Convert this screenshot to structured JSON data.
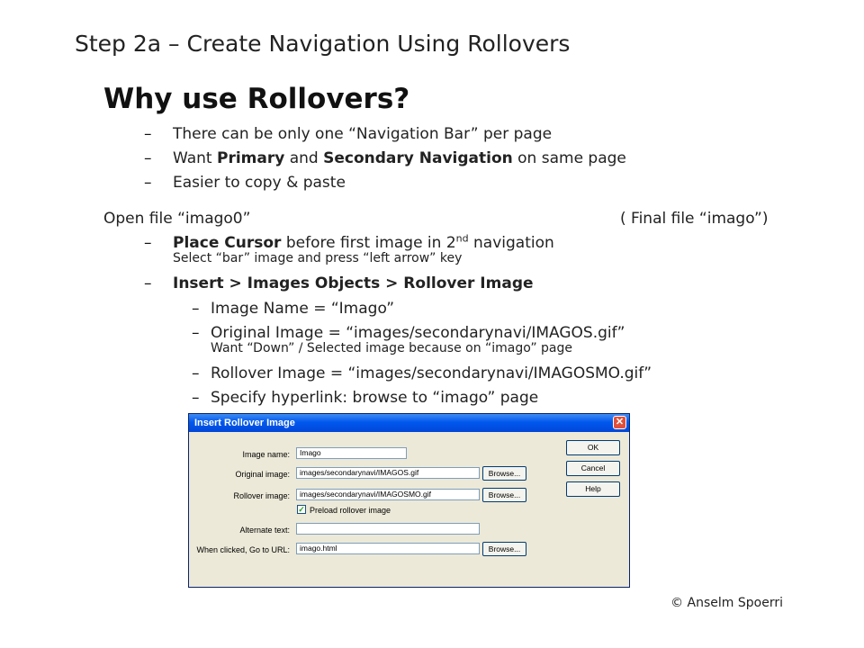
{
  "title": "Step 2a – Create Navigation Using Rollovers",
  "heading": "Why use Rollovers?",
  "dash": "–",
  "reasons": [
    {
      "pre": "There can be only one “Navigation Bar” per page"
    },
    {
      "pre": "Want ",
      "b1": "Primary",
      "mid": " and ",
      "b2": "Secondary Navigation",
      "post": " on same page"
    },
    {
      "pre": "Easier to copy & paste"
    }
  ],
  "open_file": "Open file “imago0”",
  "final_file": "( Final file “imago”)",
  "step1": {
    "bold": "Place Cursor",
    "text": " before first image in 2",
    "sup": "nd",
    "post": " navigation",
    "note": "Select “bar” image and press “left arrow” key"
  },
  "step2": "Insert > Images Objects > Rollover Image",
  "sub": {
    "image_name": "Image Name = “Imago”",
    "original": "Original Image = “images/secondarynavi/IMAGOS.gif”",
    "original_note": "Want “Down” / Selected image because on “imago” page",
    "rollover": "Rollover Image = “images/secondarynavi/IMAGOSMO.gif”",
    "hyperlink": "Specify hyperlink: browse to “imago” page"
  },
  "dialog": {
    "title": "Insert Rollover Image",
    "close_glyph": "✕",
    "labels": {
      "image_name": "Image name:",
      "original": "Original image:",
      "rollover": "Rollover image:",
      "alt": "Alternate text:",
      "url": "When clicked, Go to URL:"
    },
    "values": {
      "image_name": "Imago",
      "original": "images/secondarynavi/IMAGOS.gif",
      "rollover": "images/secondarynavi/IMAGOSMO.gif",
      "alt": "",
      "url": "imago.html"
    },
    "preload_label": "Preload rollover image",
    "preload_checked": true,
    "check_glyph": "✓",
    "browse": "Browse...",
    "ok": "OK",
    "cancel": "Cancel",
    "help": "Help"
  },
  "footer": "© Anselm Spoerri",
  "colors": {
    "titlebar": "#0058ee",
    "dialog_bg": "#ece9d8"
  }
}
